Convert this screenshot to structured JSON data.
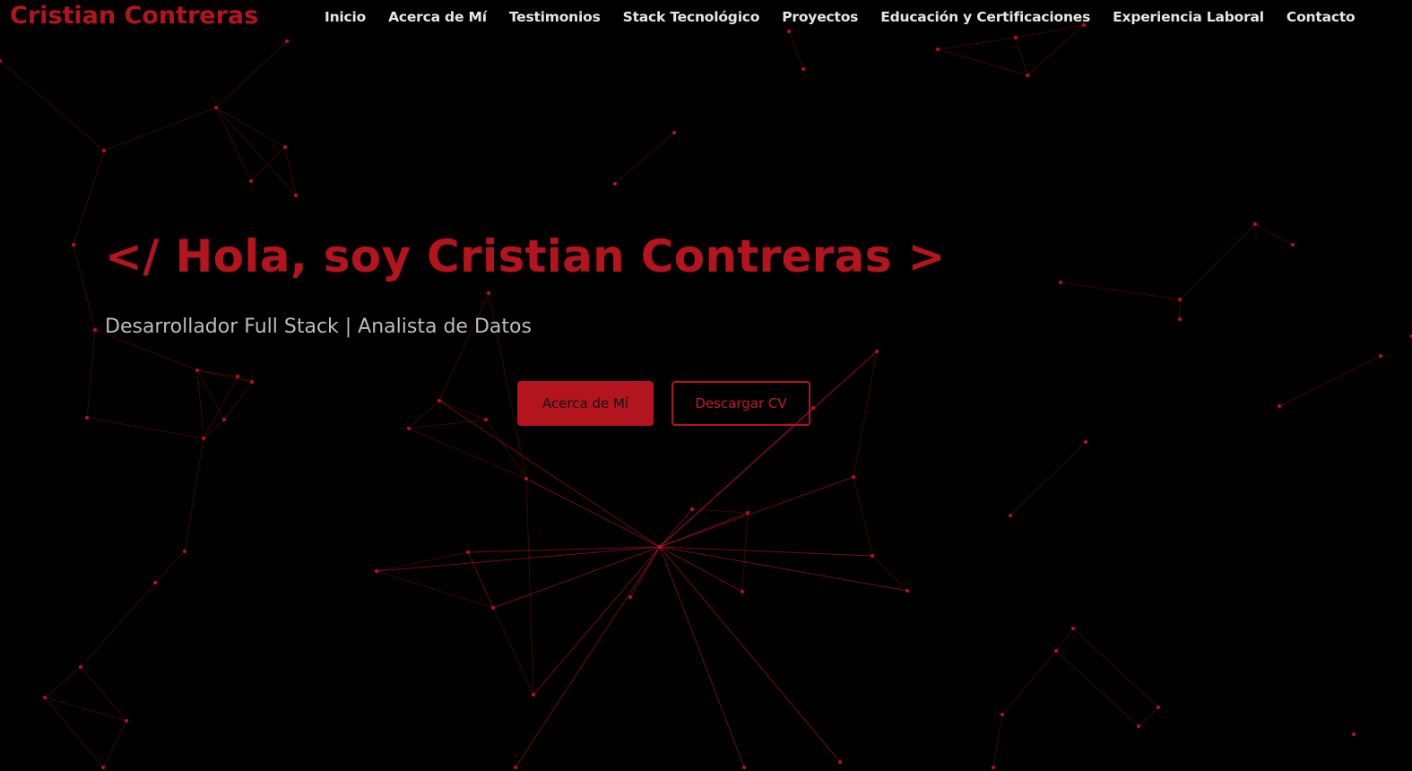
{
  "header": {
    "brand": "Cristian Contreras",
    "nav": [
      {
        "label": "Inicio"
      },
      {
        "label": "Acerca de Mí"
      },
      {
        "label": "Testimonios"
      },
      {
        "label": "Stack Tecnológico"
      },
      {
        "label": "Proyectos"
      },
      {
        "label": "Educación y Certificaciones"
      },
      {
        "label": "Experiencia Laboral"
      },
      {
        "label": "Contacto"
      }
    ]
  },
  "hero": {
    "title": "</ Hola, soy Cristian Contreras >",
    "subtitle": "Desarrollador Full Stack | Analista de Datos",
    "primary_button": "Acerca de Mí",
    "secondary_button": "Descargar CV"
  },
  "theme": {
    "background": "#000000",
    "accent": "#b3141d",
    "nav_text": "#e6e6e6",
    "subtitle_text": "#bdbdbd"
  }
}
